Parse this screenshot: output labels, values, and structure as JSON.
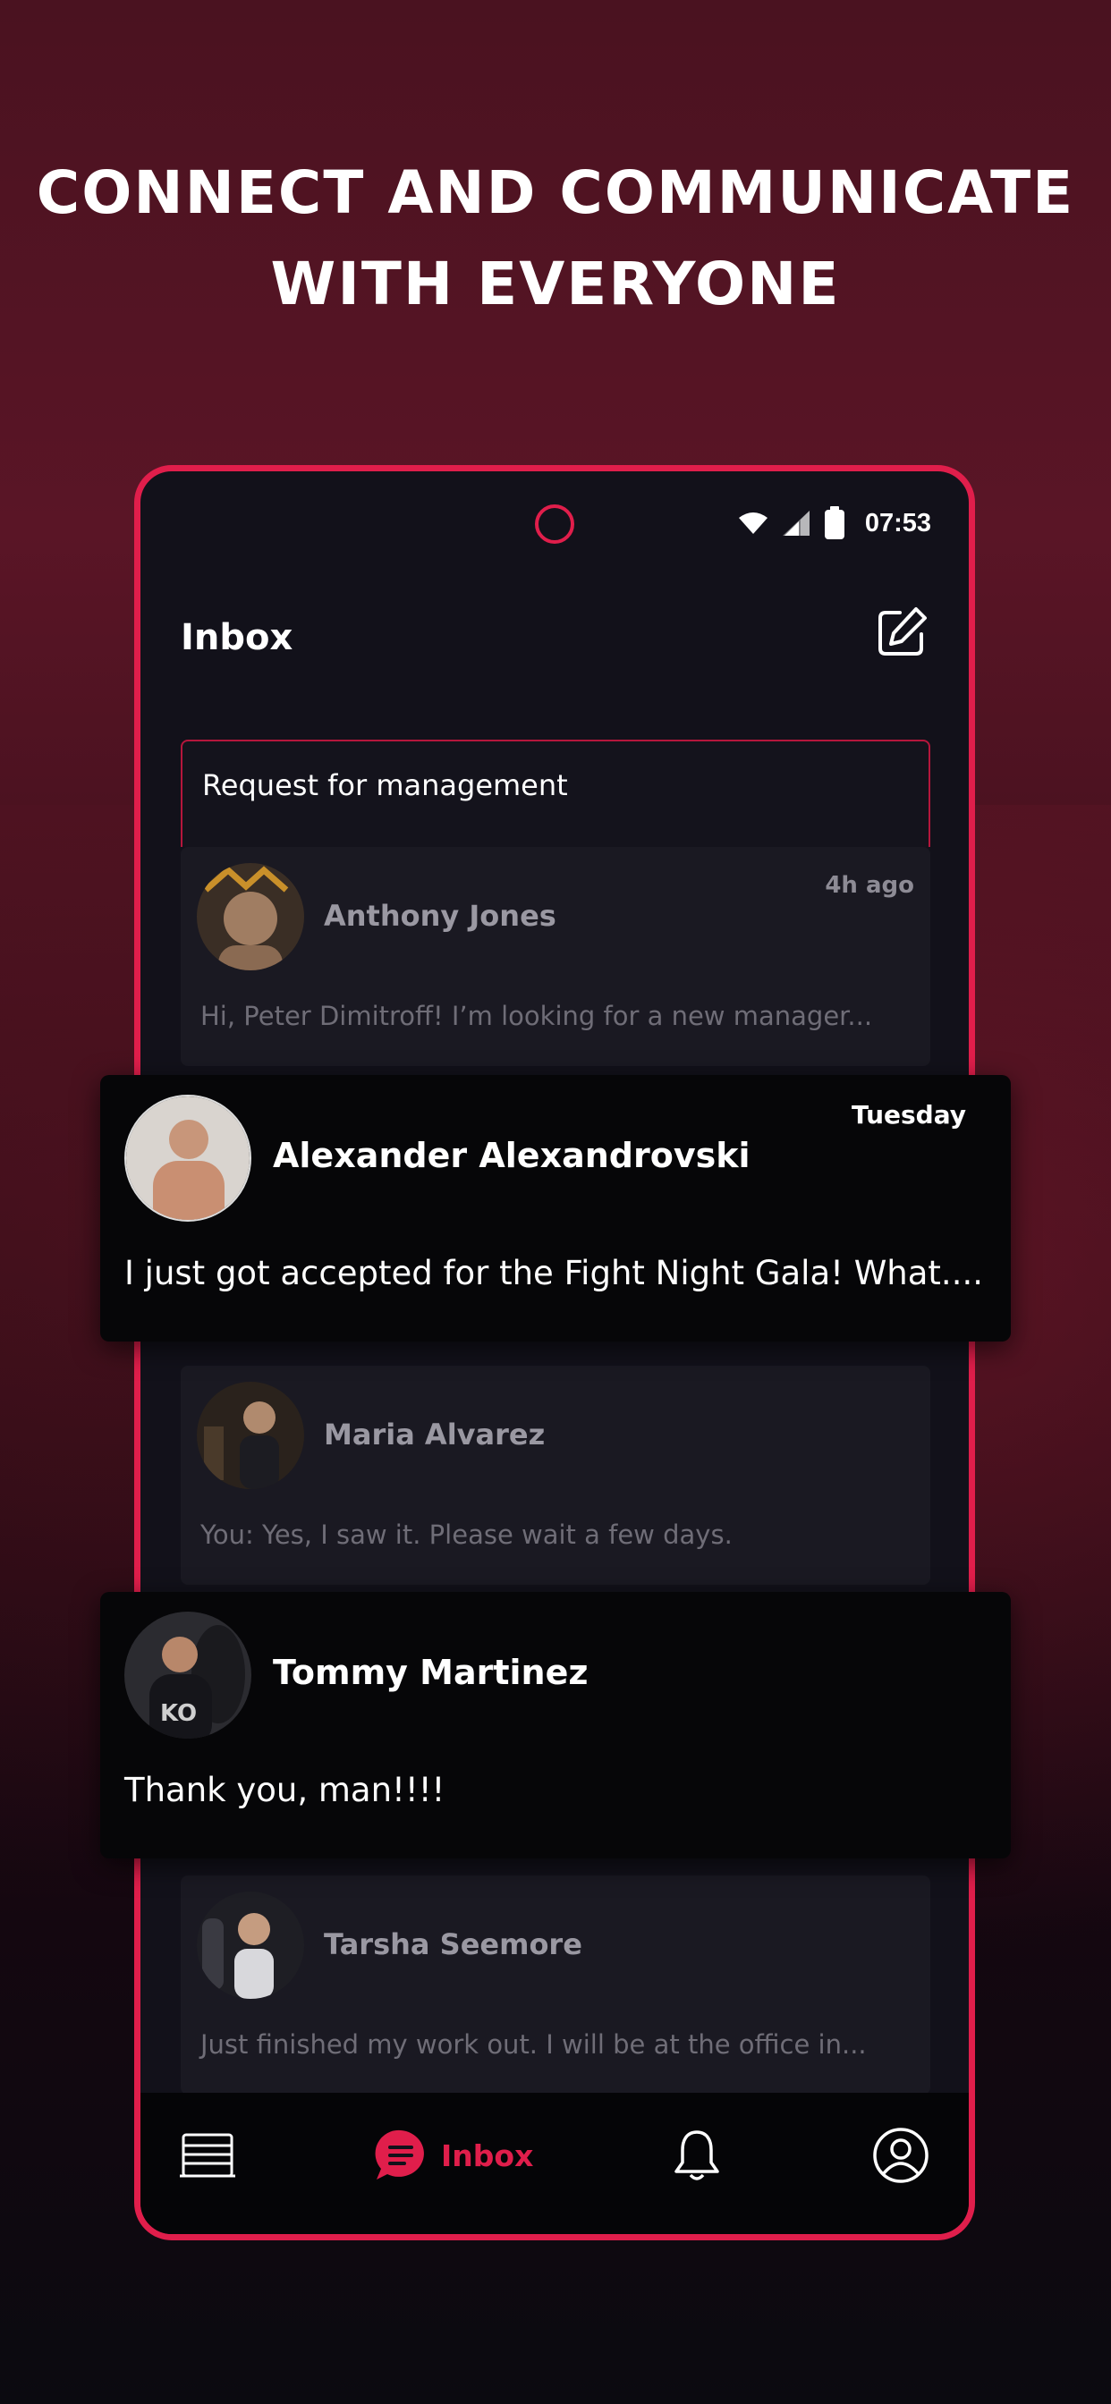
{
  "headline": {
    "line1": "CONNECT AND COMMUNICATE",
    "line2": "WITH EVERYONE"
  },
  "status_bar": {
    "time": "07:53"
  },
  "header": {
    "title": "Inbox",
    "compose_icon": "compose-icon"
  },
  "request_tab": {
    "label": "Request for management"
  },
  "conversations": [
    {
      "name": "Anthony Jones",
      "time": "4h ago",
      "preview": "Hi, Peter Dimitroff! I’m looking for a new manager..."
    },
    {
      "name": "Alexander Alexandrovski",
      "time": "Tuesday",
      "preview": "I just got accepted for the Fight Night Gala! What...."
    },
    {
      "name": "Maria Alvarez",
      "time": "",
      "preview": "You: Yes, I saw it. Please wait a few days."
    },
    {
      "name": "Tommy Martinez",
      "time": "",
      "preview": "Thank you, man!!!!"
    },
    {
      "name": "Tarsha Seemore",
      "time": "",
      "preview": "Just finished my work out. I will be at the office in..."
    }
  ],
  "bottom_nav": {
    "items": [
      {
        "icon": "ring-icon",
        "label": ""
      },
      {
        "icon": "chat-bubble-icon",
        "label": "Inbox"
      },
      {
        "icon": "bell-icon",
        "label": ""
      },
      {
        "icon": "profile-icon",
        "label": ""
      }
    ]
  },
  "colors": {
    "accent": "#e01e4b",
    "background": "#12111a",
    "card": "#1a1922"
  }
}
